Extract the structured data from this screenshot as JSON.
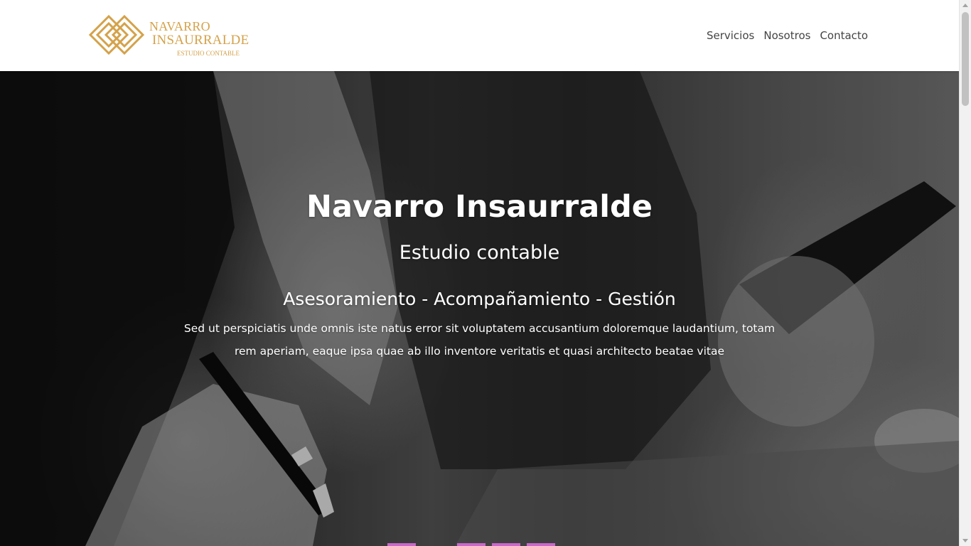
{
  "header": {
    "logo": {
      "line1": "NAVARRO",
      "line2": "INSAURRALDE",
      "line3": "ESTUDIO CONTABLE",
      "brand_color": "#d4a24a"
    },
    "nav": [
      {
        "label": "Servicios"
      },
      {
        "label": "Nosotros"
      },
      {
        "label": "Contacto"
      }
    ]
  },
  "hero": {
    "title": "Navarro Insaurralde",
    "subtitle": "Estudio contable",
    "tagline": "Asesoramiento - Acompañamiento - Gestión",
    "body": "Sed ut perspiciatis unde omnis iste natus error sit voluptatem accusantium doloremque laudantium, totam rem aperiam, eaque ipsa quae ab illo inventore veritatis et quasi architecto beatae vitae"
  },
  "colors": {
    "accent_gold": "#d4a24a",
    "nav_text": "#444444",
    "hero_text": "#ffffff",
    "strip_pink": "#c968c9"
  },
  "icons": {
    "logo_mark": "interlocking-diamonds-logo",
    "scroll_up": "scroll-up-arrow-icon",
    "scroll_down": "scroll-down-arrow-icon"
  }
}
